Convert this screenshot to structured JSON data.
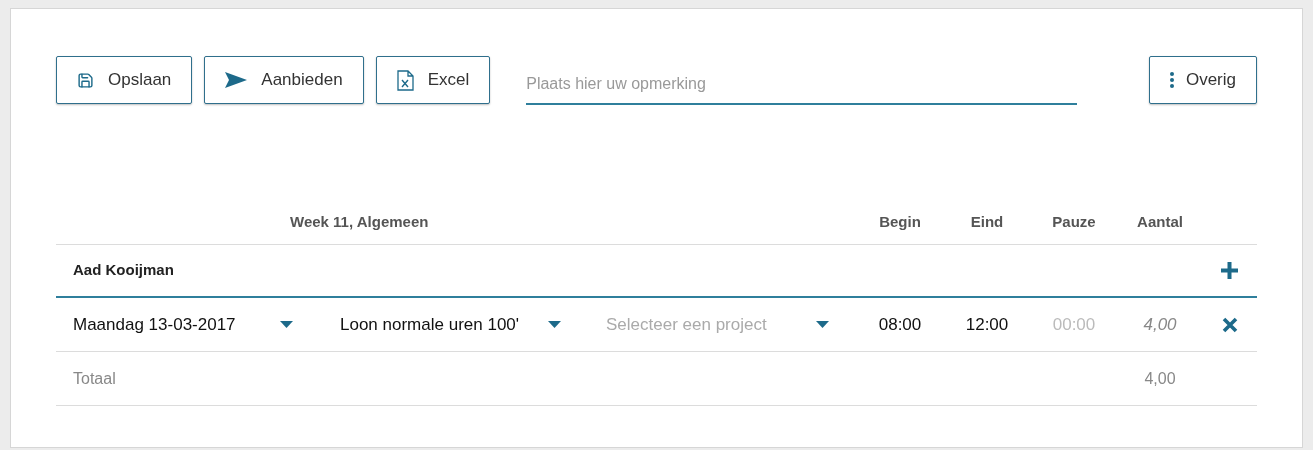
{
  "toolbar": {
    "buttons": [
      {
        "kind": "save",
        "label": "Opslaan"
      },
      {
        "kind": "send",
        "label": "Aanbieden"
      },
      {
        "kind": "excel",
        "label": "Excel"
      }
    ],
    "comment": {
      "placeholder": "Plaats hier uw opmerking"
    },
    "more": {
      "label": "Overig"
    }
  },
  "table": {
    "title": "Week 11, Algemeen",
    "columns": [
      "Begin",
      "Eind",
      "Pauze",
      "Aantal"
    ],
    "group": {
      "name": "Aad Kooijman"
    },
    "rows": [
      {
        "date": "Maandag 13-03-2017",
        "type": "Loon normale uren 100'",
        "project": {
          "placeholder": "Selecteer een project"
        },
        "begin": "08:00",
        "end": "12:00",
        "pause": {
          "placeholder": "00:00"
        },
        "amount": "4,00"
      }
    ],
    "total": {
      "label": "Totaal",
      "value": "4,00"
    }
  }
}
